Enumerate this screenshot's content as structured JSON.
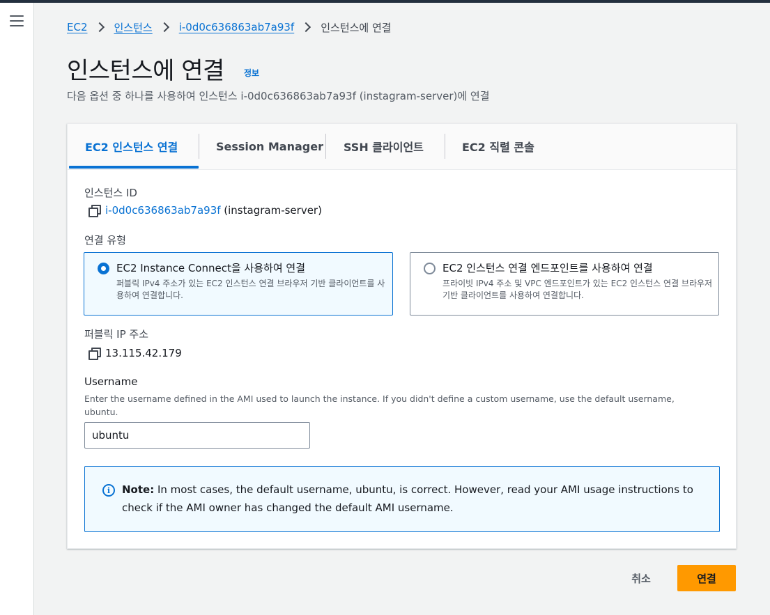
{
  "breadcrumb": {
    "items": [
      "EC2",
      "인스턴스",
      "i-0d0c636863ab7a93f"
    ],
    "current": "인스턴스에 연결"
  },
  "page": {
    "title": "인스턴스에 연결",
    "info_link": "정보",
    "description": "다음 옵션 중 하나를 사용하여 인스턴스 i-0d0c636863ab7a93f (instagram-server)에 연결"
  },
  "tabs": [
    {
      "label": "EC2 인스턴스 연결",
      "active": true
    },
    {
      "label": "Session Manager",
      "active": false
    },
    {
      "label": "SSH 클라이언트",
      "active": false
    },
    {
      "label": "EC2 직렬 콘솔",
      "active": false
    }
  ],
  "instance": {
    "label": "인스턴스 ID",
    "id": "i-0d0c636863ab7a93f",
    "name": " (instagram-server)"
  },
  "connection_type": {
    "label": "연결 유형",
    "options": [
      {
        "title": "EC2 Instance Connect을 사용하여 연결",
        "description": "퍼블릭 IPv4 주소가 있는 EC2 인스턴스 연결 브라우저 기반 클라이언트를 사용하여 연결합니다.",
        "selected": true
      },
      {
        "title": "EC2 인스턴스 연결 엔드포인트를 사용하여 연결",
        "description": "프라이빗 IPv4 주소 및 VPC 엔드포인트가 있는 EC2 인스턴스 연결 브라우저 기반 클라이언트를 사용하여 연결합니다.",
        "selected": false
      }
    ]
  },
  "public_ip": {
    "label": "퍼블릭 IP 주소",
    "value": "13.115.42.179"
  },
  "username": {
    "label": "Username",
    "description": "Enter the username defined in the AMI used to launch the instance. If you didn't define a custom username, use the default username, ubuntu.",
    "value": "ubuntu"
  },
  "note": {
    "prefix": "Note:",
    "text": " In most cases, the default username, ubuntu, is correct. However, read your AMI usage instructions to check if the AMI owner has changed the default AMI username."
  },
  "footer": {
    "cancel_label": "취소",
    "connect_label": "연결"
  },
  "colors": {
    "link": "#0972d3",
    "primary_button": "#ff9900",
    "header_bar": "#232f3e"
  }
}
